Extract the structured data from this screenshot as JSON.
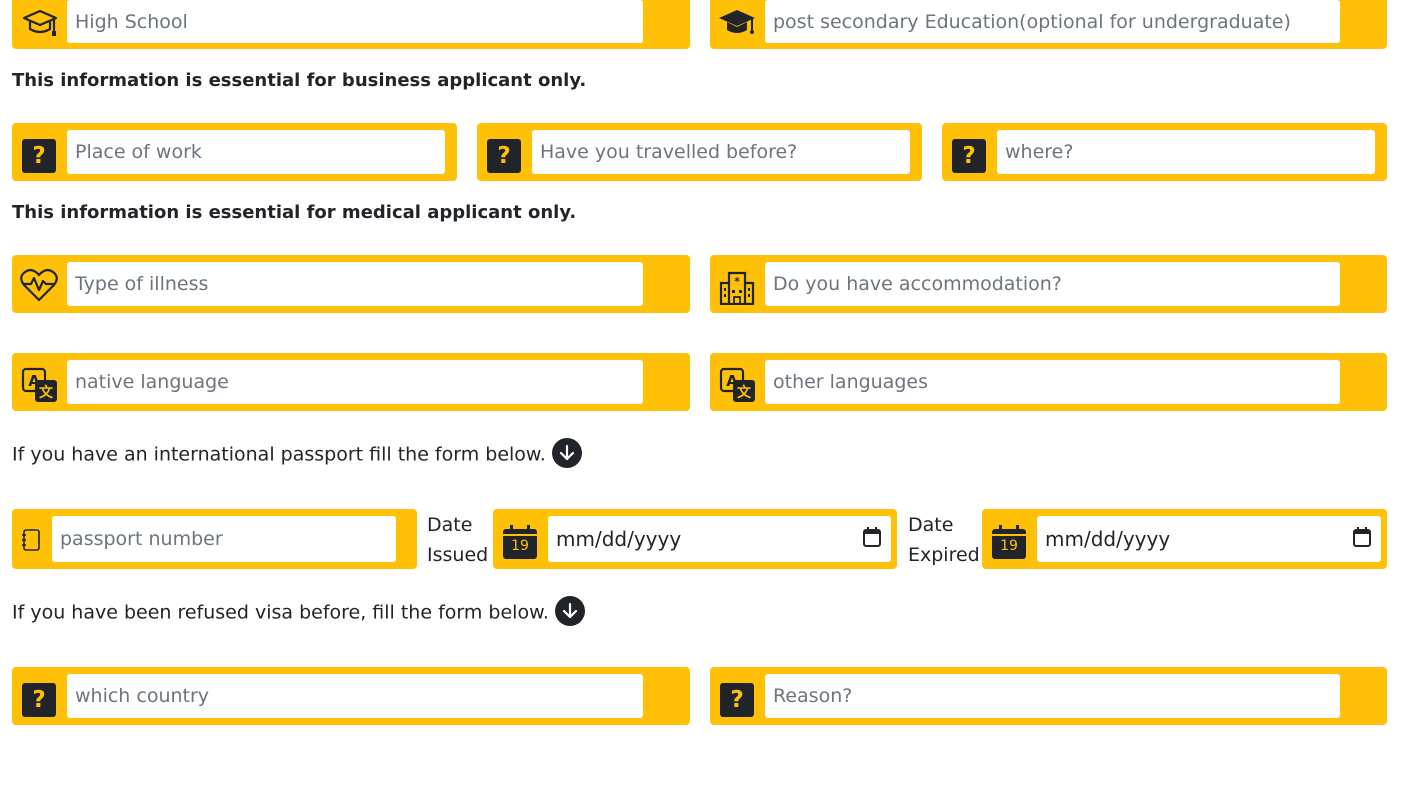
{
  "education": {
    "high_school_placeholder": "High School",
    "post_secondary_placeholder": "post secondary Education(optional for undergraduate)"
  },
  "business": {
    "note": "This information is essential for business applicant only.",
    "place_of_work_placeholder": "Place of work",
    "travelled_placeholder": "Have you travelled before?",
    "where_placeholder": "where?",
    "icon_glyph": "?"
  },
  "medical": {
    "note": "This information is essential for medical applicant only.",
    "illness_placeholder": "Type of illness",
    "accommodation_placeholder": "Do you have accommodation?"
  },
  "languages": {
    "native_placeholder": "native language",
    "other_placeholder": "other languages"
  },
  "passport": {
    "note": "If you have an international passport fill the form below.",
    "number_placeholder": "passport number",
    "date_issued_line1": "Date",
    "date_issued_line2": "Issued",
    "date_expired_line1": "Date",
    "date_expired_line2": "Expired",
    "date_format": "mm/dd/yyyy",
    "calendar_day": "19"
  },
  "visa_refusal": {
    "note": "If you have been refused visa before, fill the form below.",
    "country_placeholder": "which country",
    "reason_placeholder": "Reason?"
  },
  "colors": {
    "accent": "#ffc107",
    "dark": "#212529",
    "placeholder": "#6c757d"
  },
  "icons": [
    "graduation-cap-icon",
    "mortarboard-icon",
    "question-icon",
    "heart-pulse-icon",
    "hospital-icon",
    "translate-icon",
    "passport-icon",
    "calendar-icon",
    "arrow-down-circle-icon"
  ]
}
